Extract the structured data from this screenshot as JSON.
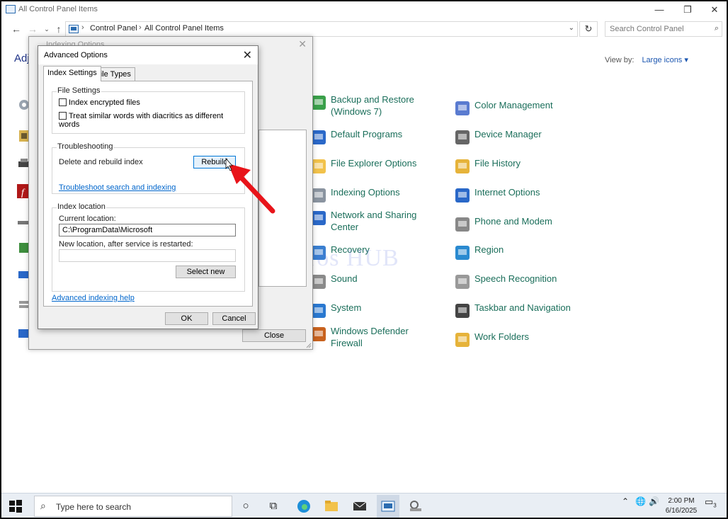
{
  "window": {
    "title": "All Control Panel Items",
    "minimize": "—",
    "maximize": "❐",
    "close": "✕"
  },
  "address": {
    "crumbs": [
      "Control Panel",
      "All Control Panel Items"
    ],
    "search_placeholder": "Search Control Panel"
  },
  "heading": "Adj",
  "view_by": {
    "label": "View by:",
    "value": "Large icons ▾"
  },
  "items_col1": [
    {
      "label": "Backup and Restore (Windows 7)",
      "icon": "backup-icon"
    },
    {
      "label": "Default Programs",
      "icon": "default-programs-icon"
    },
    {
      "label": "File Explorer Options",
      "icon": "folder-options-icon"
    },
    {
      "label": "Indexing Options",
      "icon": "indexing-icon"
    },
    {
      "label": "Network and Sharing Center",
      "icon": "network-icon"
    },
    {
      "label": "Recovery",
      "icon": "recovery-icon"
    },
    {
      "label": "Sound",
      "icon": "sound-icon"
    },
    {
      "label": "System",
      "icon": "system-icon"
    },
    {
      "label": "Windows Defender Firewall",
      "icon": "firewall-icon"
    }
  ],
  "items_col2": [
    {
      "label": "Color Management",
      "icon": "color-management-icon"
    },
    {
      "label": "Device Manager",
      "icon": "device-manager-icon"
    },
    {
      "label": "File History",
      "icon": "file-history-icon"
    },
    {
      "label": "Internet Options",
      "icon": "internet-options-icon"
    },
    {
      "label": "Phone and Modem",
      "icon": "phone-modem-icon"
    },
    {
      "label": "Region",
      "icon": "region-icon"
    },
    {
      "label": "Speech Recognition",
      "icon": "speech-icon"
    },
    {
      "label": "Taskbar and Navigation",
      "icon": "taskbar-nav-icon"
    },
    {
      "label": "Work Folders",
      "icon": "work-folders-icon"
    }
  ],
  "indexing_window": {
    "title": "Indexing Options",
    "close_label": "Close"
  },
  "dialog": {
    "title": "Advanced Options",
    "tabs": [
      "Index Settings",
      "File Types"
    ],
    "file_settings": {
      "title": "File Settings",
      "cb1": "Index encrypted files",
      "cb2": "Treat similar words with diacritics as different words"
    },
    "troubleshooting": {
      "title": "Troubleshooting",
      "label": "Delete and rebuild index",
      "rebuild": "Rebuild",
      "link": "Troubleshoot search and indexing"
    },
    "index_location": {
      "title": "Index location",
      "current_label": "Current location:",
      "current_value": "C:\\ProgramData\\Microsoft",
      "new_label": "New location, after service is restarted:",
      "new_value": "",
      "select_new": "Select new"
    },
    "help_link": "Advanced indexing help",
    "ok": "OK",
    "cancel": "Cancel"
  },
  "watermark": "IT Pros HUB",
  "taskbar": {
    "search_placeholder": "Type here to search",
    "time": "2:00 PM",
    "date": "6/16/2025",
    "notif_count": "3"
  }
}
